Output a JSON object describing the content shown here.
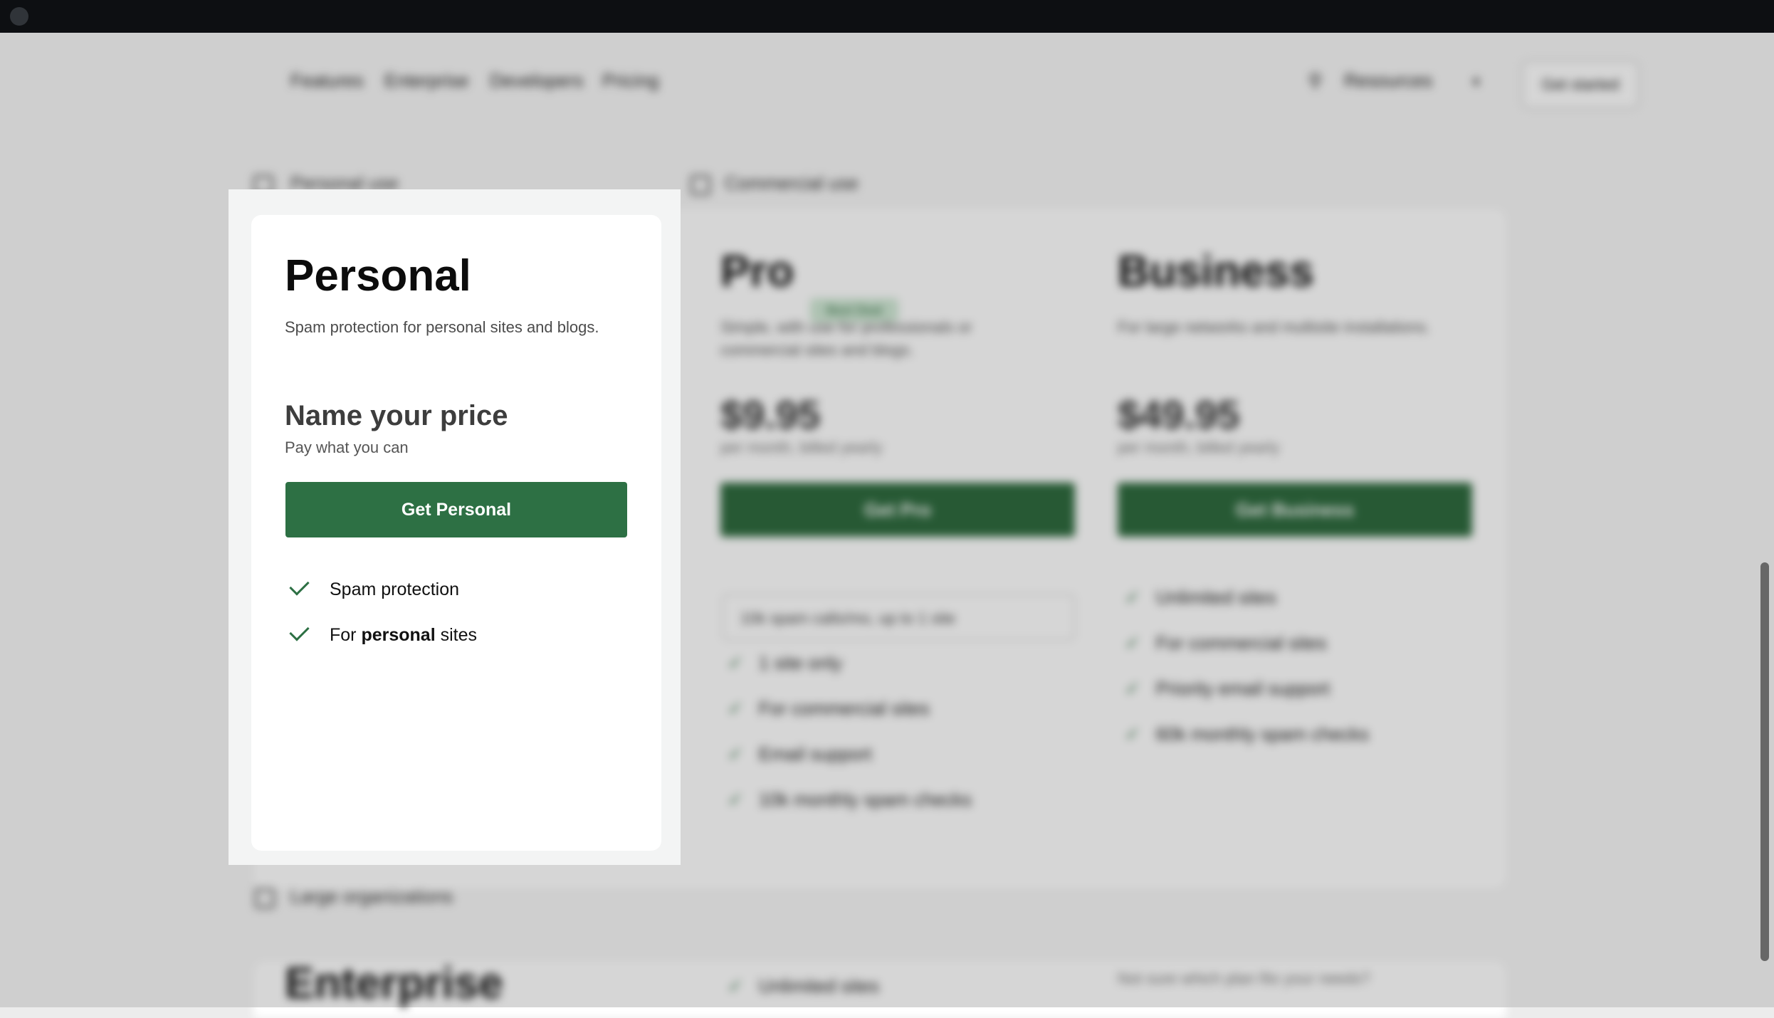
{
  "nav": {
    "links": [
      "Features",
      "Enterprise",
      "Developers",
      "Pricing"
    ],
    "resources_label": "Resources",
    "get_started_label": "Get started"
  },
  "sections": {
    "personal_label": "Personal use",
    "commercial_label": "Commercial use",
    "large_label": "Large organizations"
  },
  "background_plans": {
    "pro": {
      "name": "Pro",
      "badge": "Best Deal",
      "description": "Simple, with use for professionals or commercial sites and blogs.",
      "price": "$9.95",
      "price_note": "per month, billed yearly",
      "button": "Get Pro",
      "select_value": "10k spam calls/mo, up to 1 site",
      "features": [
        "1 site only",
        "For commercial sites",
        "Email support",
        "10k monthly spam checks"
      ]
    },
    "business": {
      "name": "Business",
      "description": "For large networks and multisite installations.",
      "price": "$49.95",
      "price_note": "per month, billed yearly",
      "button": "Get Business",
      "features": [
        "Unlimited sites",
        "For commercial sites",
        "Priority email support",
        "60k monthly spam checks"
      ]
    },
    "enterprise": {
      "name": "Enterprise",
      "feature": "Unlimited sites",
      "note": "Not sure which plan fits your needs?"
    }
  },
  "personal": {
    "title": "Personal",
    "description": "Spam protection for personal sites and blogs.",
    "price_heading": "Name your price",
    "price_sub": "Pay what you can",
    "button": "Get Personal",
    "features": [
      {
        "text": "Spam protection"
      },
      {
        "prefix": "For ",
        "bold": "personal",
        "suffix": " sites"
      }
    ]
  },
  "colors": {
    "brand_green": "#2d7044",
    "topbar": "#101316",
    "panel_bg": "#f3f4f4"
  }
}
